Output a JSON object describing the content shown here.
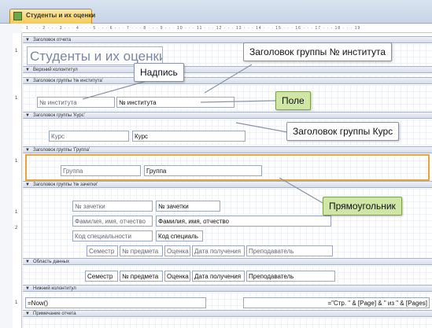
{
  "window": {
    "tab_title": "Студенты и их оценки",
    "ruler": "· 1 · · · 2 · · · 3 · · · 4 · · · 5 · · · 6 · · · 7 · · · 8 · · · 9 · · · 10 · · · 11 · · · 12 · · · 13 · · · 14 · · · 15 · · · 16 · · · 17 · · · 18 · · · 19"
  },
  "bands": {
    "report_header": "Заголовок отчета",
    "page_header": "Верхний колонтитул",
    "group_institute": "Заголовок группы '№ института'",
    "group_course": "Заголовок группы 'Курс'",
    "group_group": "Заголовок группы 'Группа'",
    "group_record": "Заголовок группы '№ зачетки'",
    "detail": "Область данных",
    "page_footer": "Нижний колонтитул",
    "report_footer": "Примечание отчета"
  },
  "controls": {
    "report_title": "Студенты и их оценки",
    "institute_label": "№ института",
    "institute_field": "№ института",
    "course_label": "Курс",
    "course_field": "Курс",
    "group_label": "Группа",
    "group_field": "Группа",
    "record_label": "№ зачетки",
    "record_field": "№ зачетки",
    "fio_label": "Фамилия, имя, отчество",
    "fio_field": "Фамилия, имя, отчество",
    "spec_label": "Код специальности",
    "spec_field": "Код специаль",
    "detail_labels": [
      "Семестр",
      "№ предмета",
      "Оценка",
      "Дата получения",
      "Преподаватель"
    ],
    "detail_fields": [
      "Семестр",
      "№ предмета",
      "Оценка",
      "Дата получения",
      "Преподаватель"
    ],
    "now_field": "=Now()",
    "page_field": "=\"Стр. \" & [Page] & \" из \" & [Pages]"
  },
  "callouts": {
    "caption": "Надпись",
    "institute_header": "Заголовок группы № института",
    "field": "Поле",
    "course_header": "Заголовок группы Курс",
    "rectangle": "Прямоугольник"
  },
  "colors": {
    "highlight": "#e8a43a",
    "green_callout": "#cfe6a8"
  }
}
